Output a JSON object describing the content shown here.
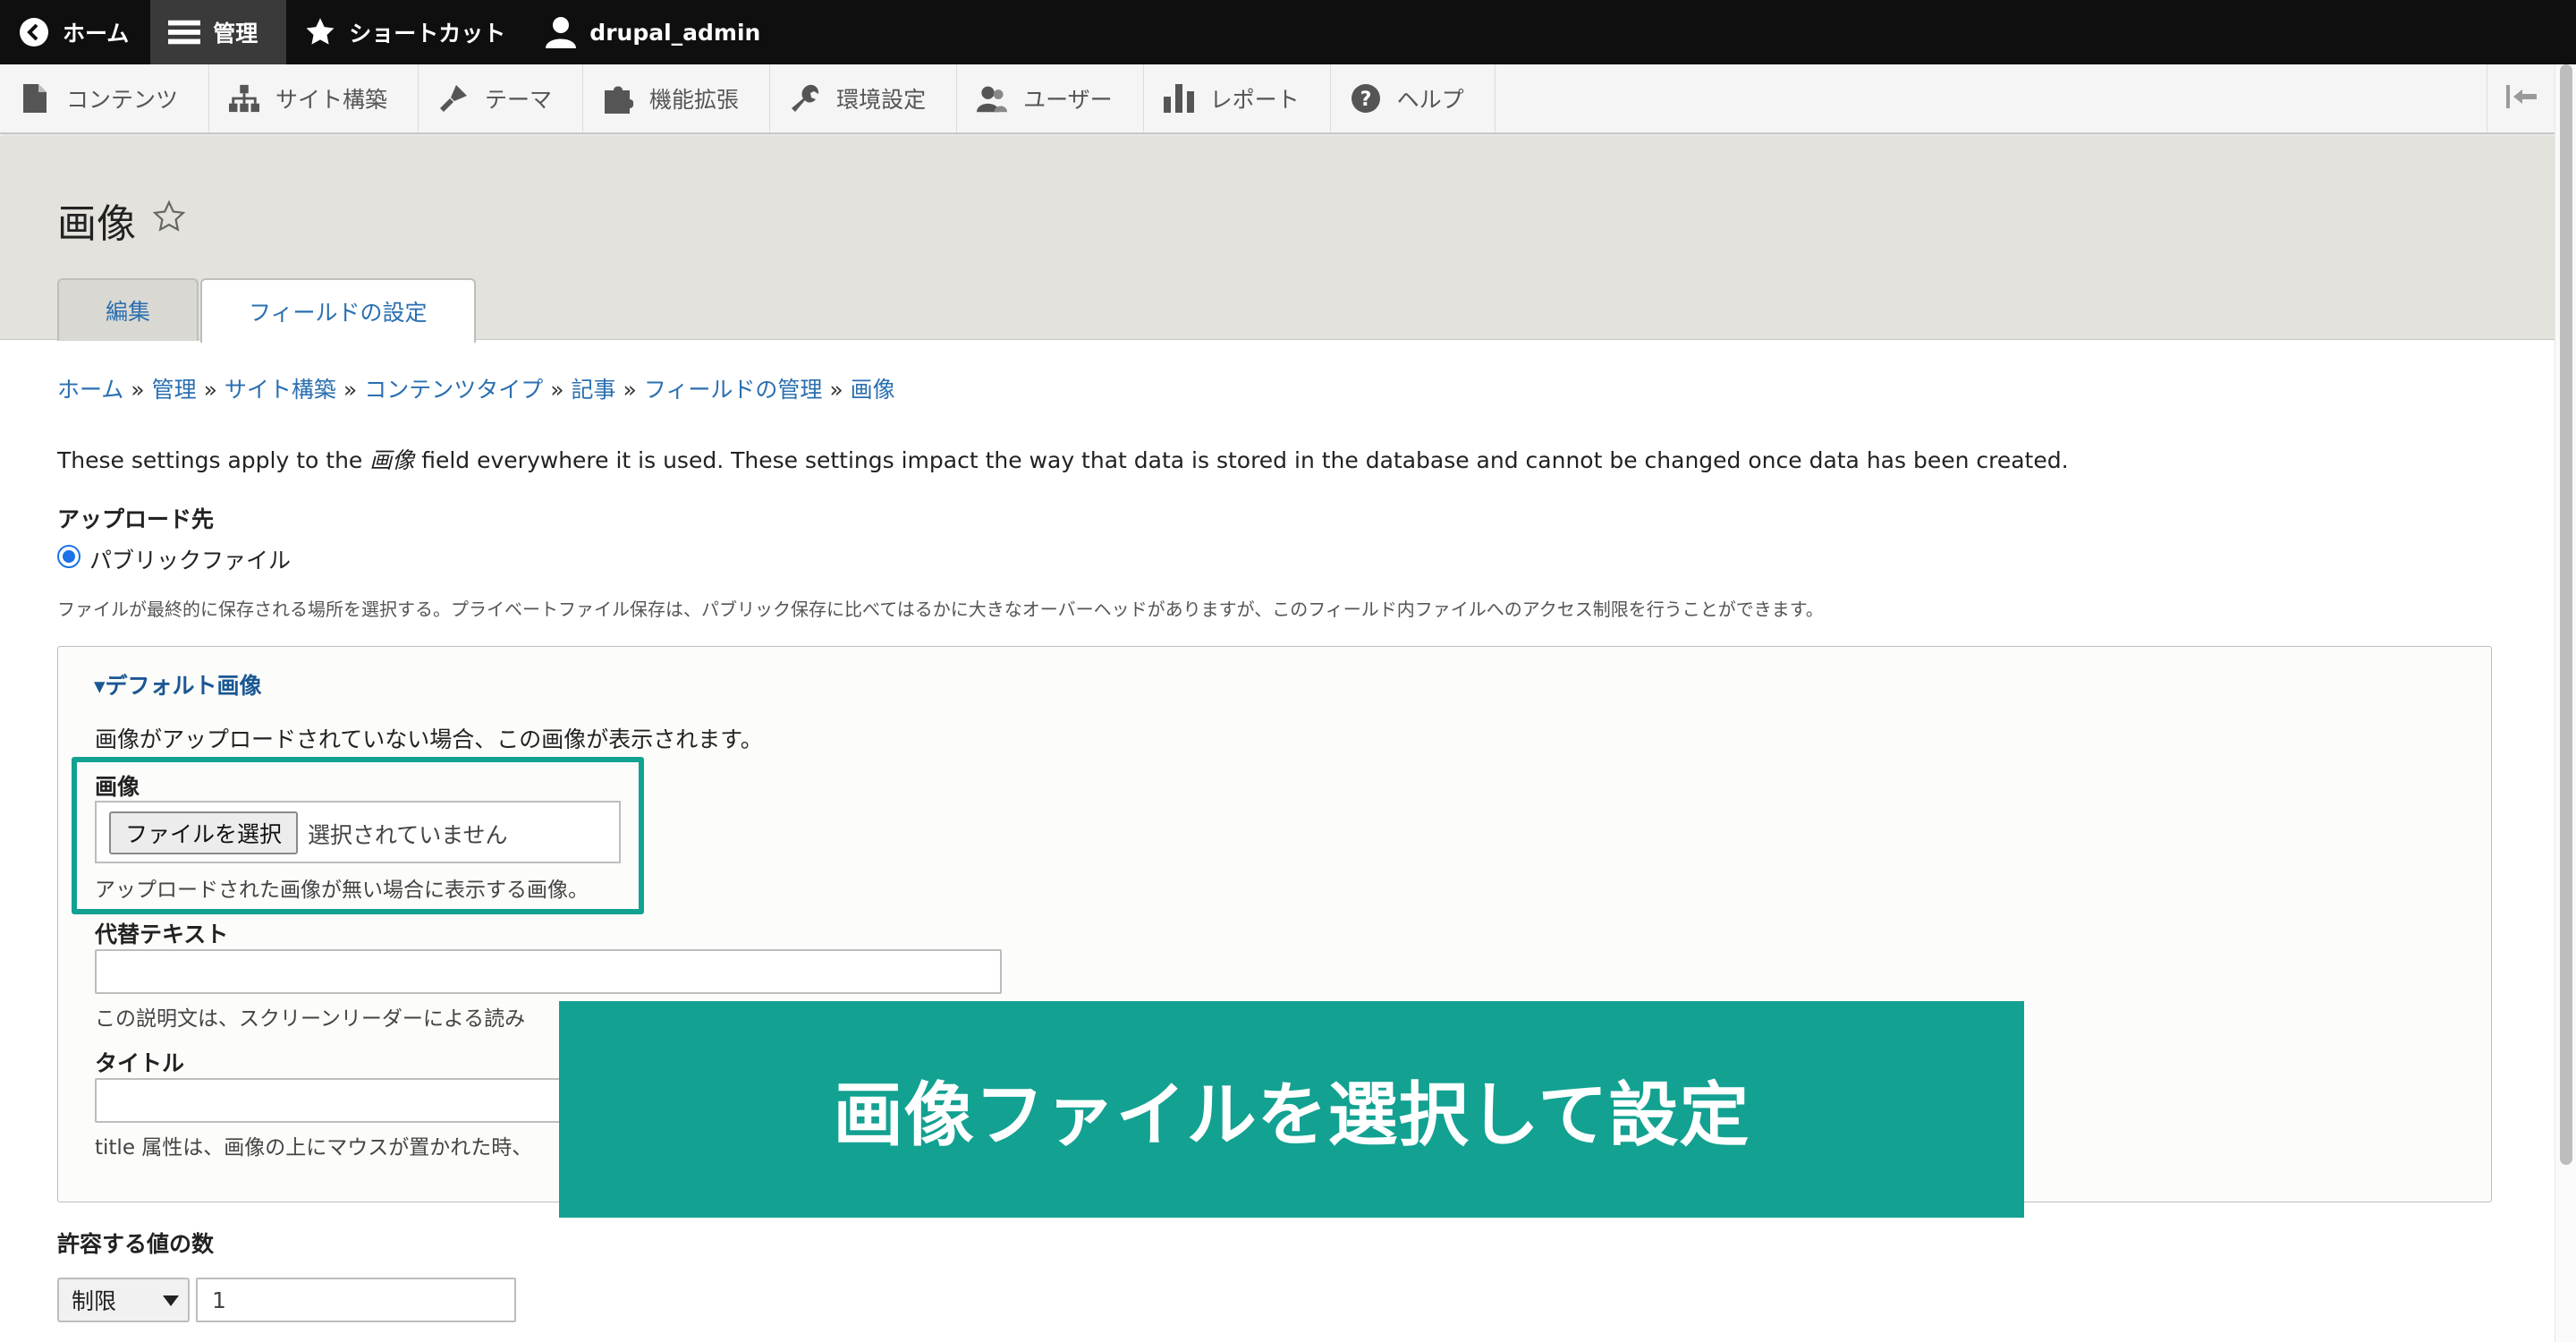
{
  "toolbar": {
    "items": [
      {
        "label": "ホーム",
        "icon": "back-circle-icon"
      },
      {
        "label": "管理",
        "icon": "menu-icon"
      },
      {
        "label": "ショートカット",
        "icon": "star-icon"
      },
      {
        "label": "drupal_admin",
        "icon": "user-icon"
      }
    ]
  },
  "tray": {
    "items": [
      {
        "label": "コンテンツ",
        "icon": "file-icon"
      },
      {
        "label": "サイト構築",
        "icon": "sitemap-icon"
      },
      {
        "label": "テーマ",
        "icon": "brush-icon"
      },
      {
        "label": "機能拡張",
        "icon": "puzzle-icon"
      },
      {
        "label": "環境設定",
        "icon": "wrench-icon"
      },
      {
        "label": "ユーザー",
        "icon": "people-icon"
      },
      {
        "label": "レポート",
        "icon": "bar-chart-icon"
      },
      {
        "label": "ヘルプ",
        "icon": "help-icon"
      }
    ]
  },
  "page": {
    "title": "画像",
    "tabs": [
      {
        "label": "編集"
      },
      {
        "label": "フィールドの設定"
      }
    ]
  },
  "breadcrumb": {
    "items": [
      "ホーム",
      "管理",
      "サイト構築",
      "コンテンツタイプ",
      "記事",
      "フィールドの管理",
      "画像"
    ],
    "separator": "»"
  },
  "intro": {
    "prefix": "These settings apply to the ",
    "field_name": "画像",
    "suffix": " field everywhere it is used. These settings impact the way that data is stored in the database and cannot be changed once data has been created."
  },
  "upload": {
    "label": "アップロード先",
    "option": "パブリックファイル",
    "description": "ファイルが最終的に保存される場所を選択する。プライベートファイル保存は、パブリック保存に比べてはるかに大きなオーバーヘッドがありますが、このフィールド内ファイルへのアクセス制限を行うことができます。"
  },
  "default_image": {
    "summary": "▾デフォルト画像",
    "intro": "画像がアップロードされていない場合、この画像が表示されます。",
    "image_label": "画像",
    "file_button": "ファイルを選択",
    "file_none": "選択されていません",
    "image_description": "アップロードされた画像が無い場合に表示する画像。",
    "alt_label": "代替テキスト",
    "alt_description": "この説明文は、スクリーンリーダーによる読み",
    "title_label": "タイトル",
    "title_description": "title 属性は、画像の上にマウスが置かれた時、"
  },
  "cardinality": {
    "label": "許容する値の数",
    "select_value": "制限",
    "number_value": "1"
  },
  "overlay": {
    "text": "画像ファイルを選択して設定"
  },
  "colors": {
    "accent": "#13a191",
    "link": "#2a6fb0",
    "toolbar_bg": "#0f0f0f",
    "header_bg": "#e3e2dc"
  }
}
